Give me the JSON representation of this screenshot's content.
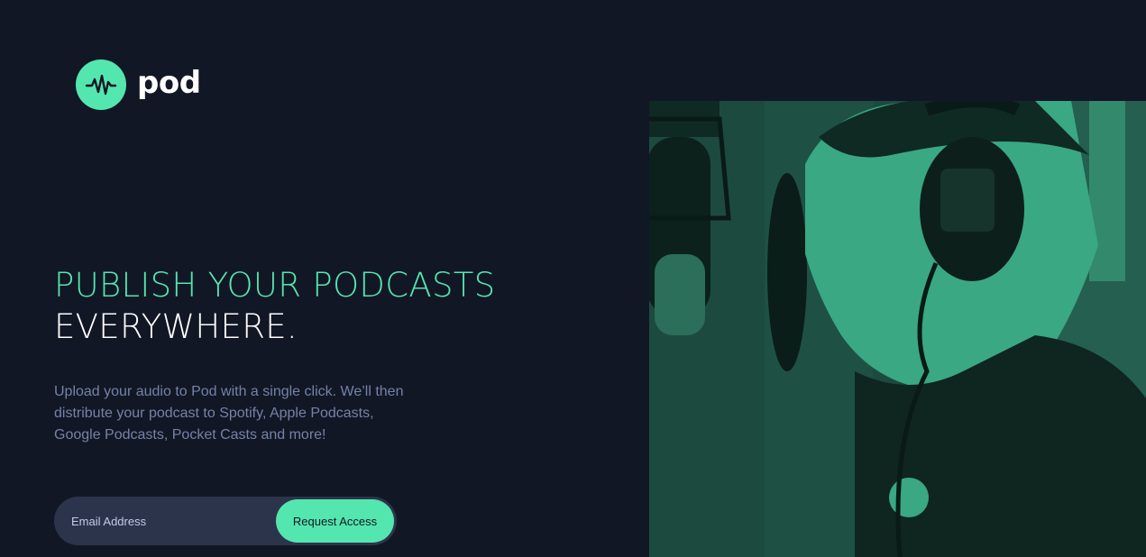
{
  "brand": {
    "name": "pod",
    "accent": "#54e6af",
    "background": "#121725"
  },
  "hero": {
    "headline_line1": "PUBLISH YOUR PODCASTS",
    "headline_line2": "EVERYWHERE.",
    "description": "Upload your audio to Pod with a single click. We’ll then distribute your podcast to Spotify, Apple Podcasts, Google Podcasts, Pocket Casts and more!"
  },
  "signup": {
    "email_placeholder": "Email Address",
    "email_value": "",
    "button_label": "Request Access"
  },
  "icons": {
    "logo": "waveform-icon"
  }
}
